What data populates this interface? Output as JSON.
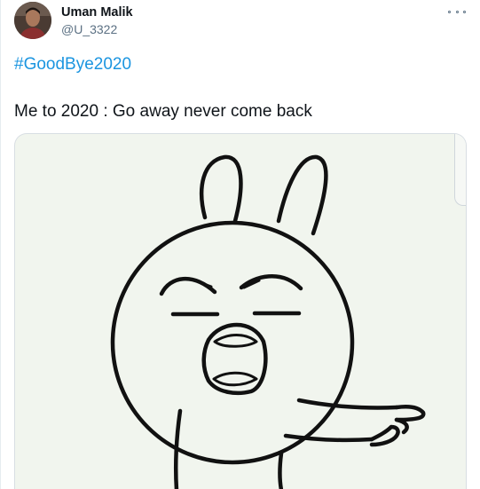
{
  "author": {
    "display_name": "Uman Malik",
    "handle": "@U_3322"
  },
  "tweet": {
    "hashtag": "#GoodBye2020",
    "text": "Me to 2020 : Go away never come back"
  },
  "icons": {
    "more": "more-options-icon",
    "avatar": "avatar"
  },
  "colors": {
    "hashtag": "#1b95e0",
    "handle": "#5b7083",
    "media_bg": "#f1f5ee"
  }
}
